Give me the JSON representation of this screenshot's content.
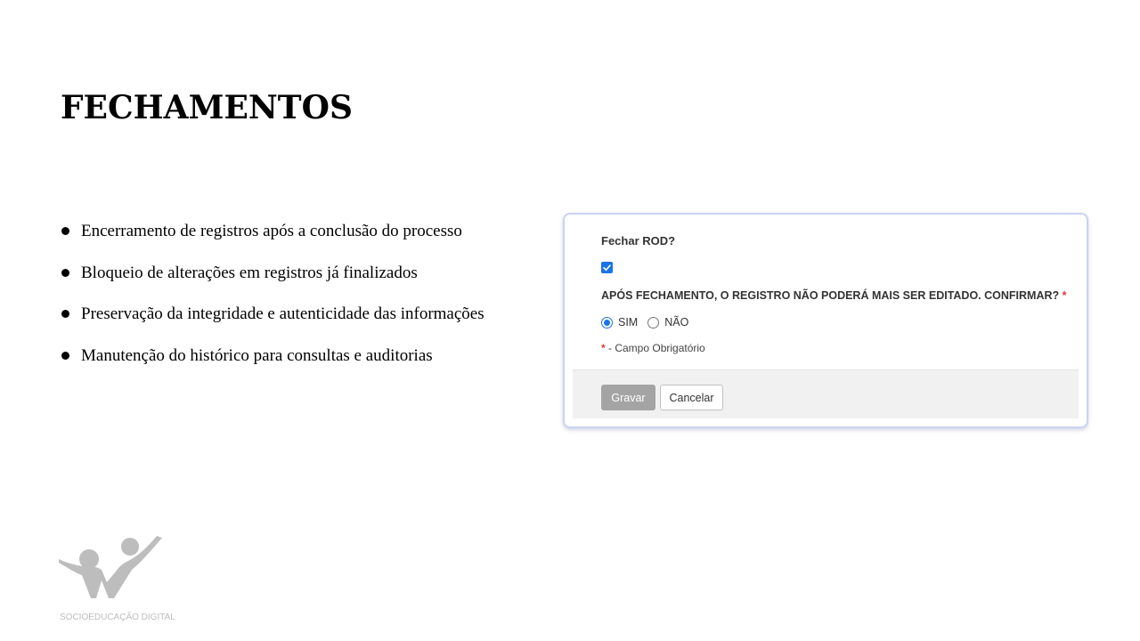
{
  "slide": {
    "title": "FECHAMENTOS",
    "bullets": [
      "Encerramento de registros após a conclusão do processo",
      "Bloqueio de alterações em registros já finalizados",
      "Preservação da integridade e autenticidade das informações",
      "Manutenção do histórico para consultas e auditorias"
    ]
  },
  "dialog": {
    "question_label": "Fechar ROD?",
    "checkbox_checked": true,
    "warning_label": "APÓS FECHAMENTO, O REGISTRO NÃO PODERÁ MAIS SER EDITADO. CONFIRMAR?",
    "required_marker": "*",
    "options": [
      {
        "label": "SIM",
        "selected": true
      },
      {
        "label": "NÃO",
        "selected": false
      }
    ],
    "required_note": "- Campo Obrigatório",
    "save_label": "Gravar",
    "cancel_label": "Cancelar"
  },
  "logo": {
    "text": "SOCIOEDUCAÇÃO DIGITAL",
    "icon": "people-logo-icon",
    "color": "#bdbdbd"
  },
  "colors": {
    "accent": "#1a73e8",
    "required": "#e03a3a",
    "dialog_border": "#c9d3f2"
  }
}
